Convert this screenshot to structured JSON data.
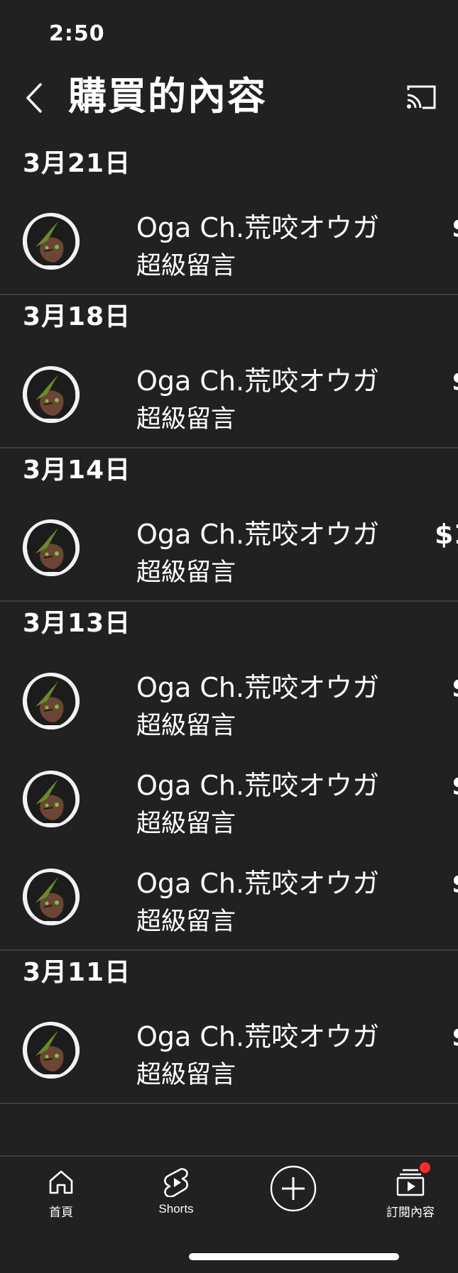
{
  "status_bar": {
    "time": "2:50"
  },
  "header": {
    "title": "購買的內容",
    "back_icon": "chevron-left-icon",
    "cast_icon": "cast-icon"
  },
  "colors": {
    "background": "#212121",
    "divider": "#3d3d3d",
    "notification": "#ff2b2b",
    "text": "#ffffff"
  },
  "purchases": [
    {
      "date": "3月21日",
      "items": [
        {
          "name": "Oga Ch.荒咬オウガ",
          "type": "超級留言",
          "price": "$"
        }
      ]
    },
    {
      "date": "3月18日",
      "items": [
        {
          "name": "Oga Ch.荒咬オウガ",
          "type": "超級留言",
          "price": "$"
        }
      ]
    },
    {
      "date": "3月14日",
      "items": [
        {
          "name": "Oga Ch.荒咬オウガ",
          "type": "超級留言",
          "price": "$1"
        }
      ]
    },
    {
      "date": "3月13日",
      "items": [
        {
          "name": "Oga Ch.荒咬オウガ",
          "type": "超級留言",
          "price": "$"
        },
        {
          "name": "Oga Ch.荒咬オウガ",
          "type": "超級留言",
          "price": "$"
        },
        {
          "name": "Oga Ch.荒咬オウガ",
          "type": "超級留言",
          "price": "$"
        }
      ]
    },
    {
      "date": "3月11日",
      "items": [
        {
          "name": "Oga Ch.荒咬オウガ",
          "type": "超級留言",
          "price": "$"
        }
      ]
    }
  ],
  "bottom_nav": {
    "home": {
      "label": "首頁",
      "icon": "home-icon"
    },
    "shorts": {
      "label": "Shorts",
      "icon": "shorts-icon"
    },
    "create": {
      "icon": "plus-circle-icon"
    },
    "subscriptions": {
      "label": "訂閱內容",
      "icon": "subscriptions-icon"
    }
  }
}
